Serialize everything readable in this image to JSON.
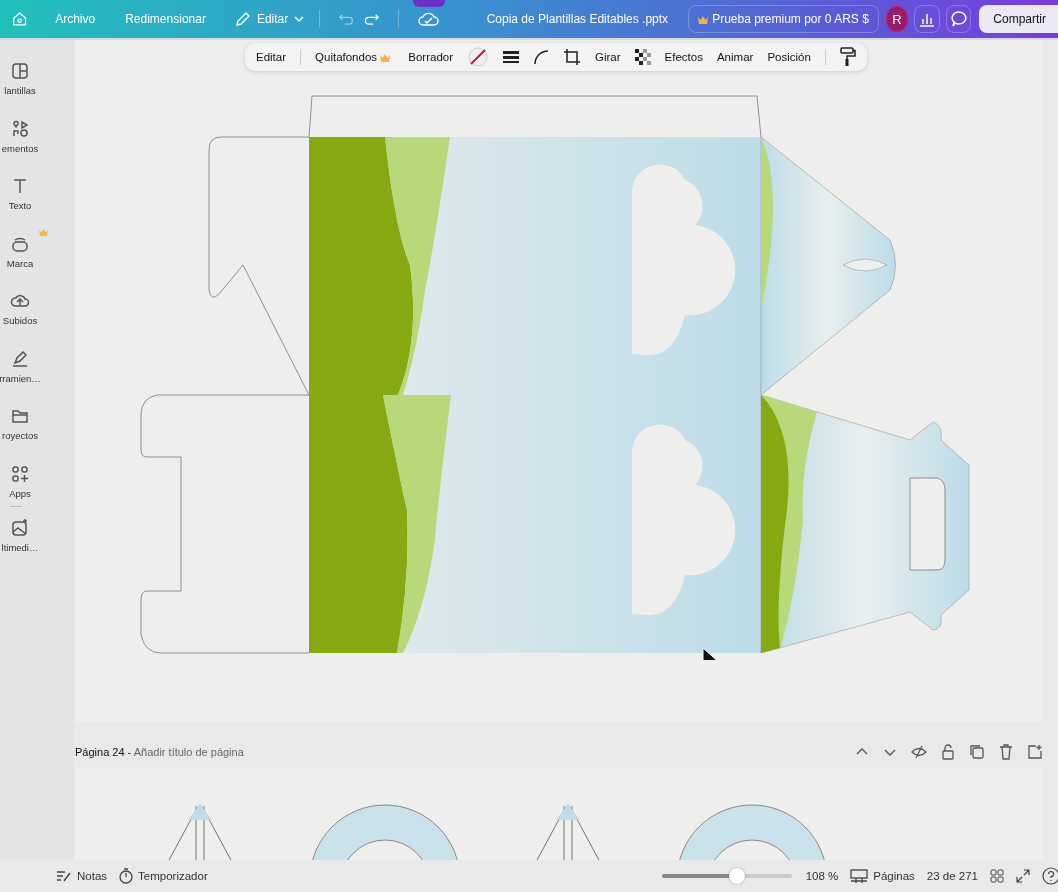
{
  "topbar": {
    "menu": [
      "Archivo",
      "Redimensionar"
    ],
    "edit_menu": "Editar",
    "document_title": "Copia de Plantillas Editables .pptx",
    "premium": "Prueba premium por 0 ARS $",
    "avatar": "R",
    "share": "Compartir"
  },
  "toolbar": [
    {
      "label": "Editar",
      "kind": "text"
    },
    {
      "label": "Quitafondos",
      "kind": "premium"
    },
    {
      "label": "Borrador",
      "kind": "text"
    },
    {
      "kind": "color"
    },
    {
      "kind": "lines"
    },
    {
      "kind": "corner"
    },
    {
      "kind": "crop"
    },
    {
      "label": "Girar",
      "kind": "text"
    },
    {
      "kind": "transparency"
    },
    {
      "label": "Efectos",
      "kind": "text"
    },
    {
      "label": "Animar",
      "kind": "text"
    },
    {
      "label": "Posición",
      "kind": "text"
    },
    {
      "kind": "paint"
    }
  ],
  "sidebar": [
    {
      "label": "lantillas",
      "premium": false
    },
    {
      "label": "ementos",
      "premium": false
    },
    {
      "label": "Texto",
      "premium": false
    },
    {
      "label": "Marca",
      "premium": true
    },
    {
      "label": "Subidos",
      "premium": false
    },
    {
      "label": "rramien…",
      "premium": false
    },
    {
      "label": "royectos",
      "premium": false
    },
    {
      "label": "Apps",
      "premium": false
    },
    {
      "label": "ltimedi…",
      "premium": false
    }
  ],
  "page_header": {
    "page": "Página 24",
    "separator": "-",
    "title_placeholder": "Añadir título de página"
  },
  "bottom_bar": {
    "notes": "Notas",
    "timer": "Temporizador",
    "zoom": {
      "level": 0.58
    },
    "zoom_value": "108 %",
    "pages": "Páginas",
    "page_count": "23 de 271"
  }
}
